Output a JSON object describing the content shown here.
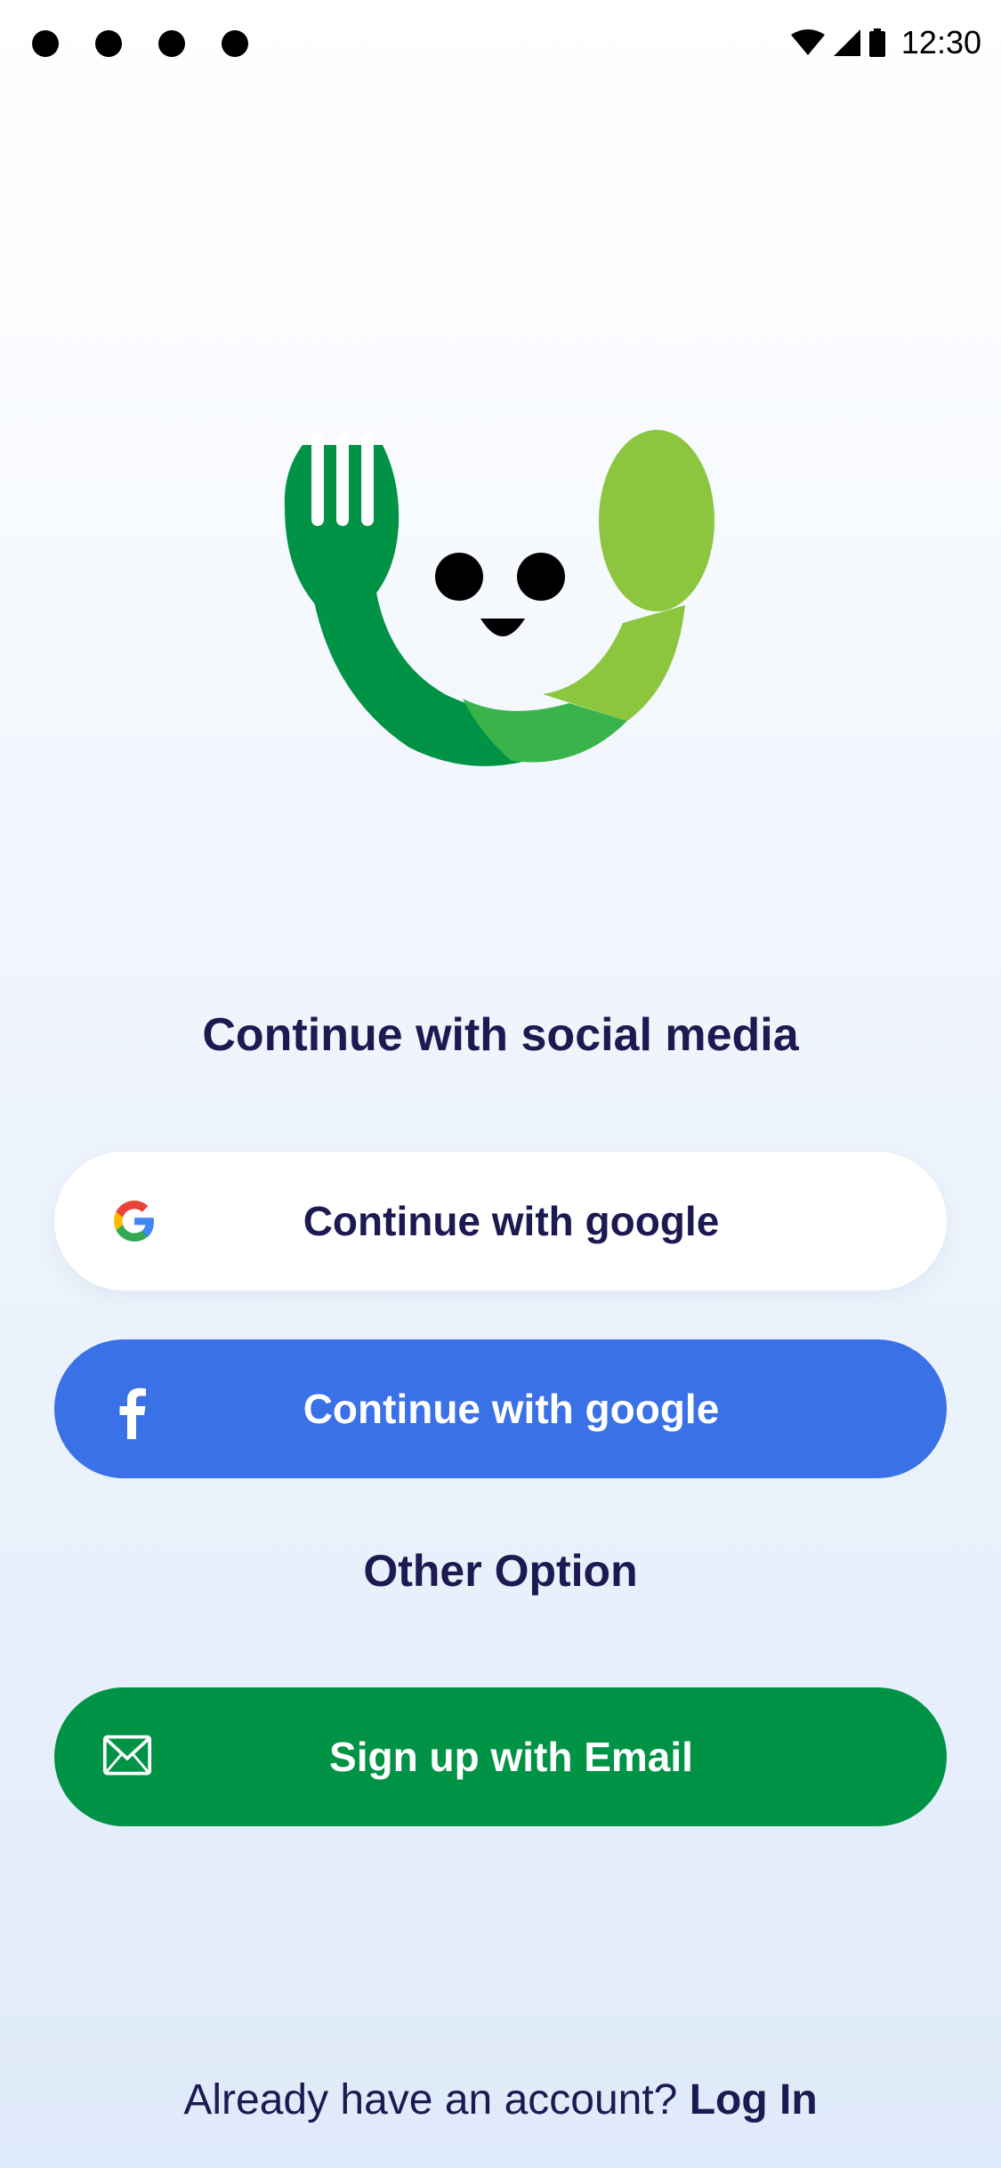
{
  "status_bar": {
    "time": "12:30",
    "icons": [
      "wifi-icon",
      "cellular-signal-icon",
      "battery-icon"
    ]
  },
  "logo": {
    "name": "fork-spoon-smiley-logo",
    "colors": {
      "dark_green": "#009345",
      "mid_green": "#3ab44a",
      "light_green": "#8cc63f",
      "face": "#000000"
    }
  },
  "heading": "Continue with social media",
  "buttons": {
    "google": {
      "label": "Continue with google",
      "icon": "google-icon",
      "background": "#ffffff"
    },
    "facebook": {
      "label": "Continue with google",
      "icon": "facebook-icon",
      "background": "#3b71e6"
    },
    "email": {
      "label": "Sign up with Email",
      "icon": "envelope-icon",
      "background": "#009345"
    }
  },
  "other_option": "Other Option",
  "footer": {
    "prompt": "Already have an account?",
    "login_label": "Log In"
  },
  "colors": {
    "text_primary": "#1d1a52",
    "brand_green": "#009345",
    "facebook_blue": "#3b71e6"
  }
}
